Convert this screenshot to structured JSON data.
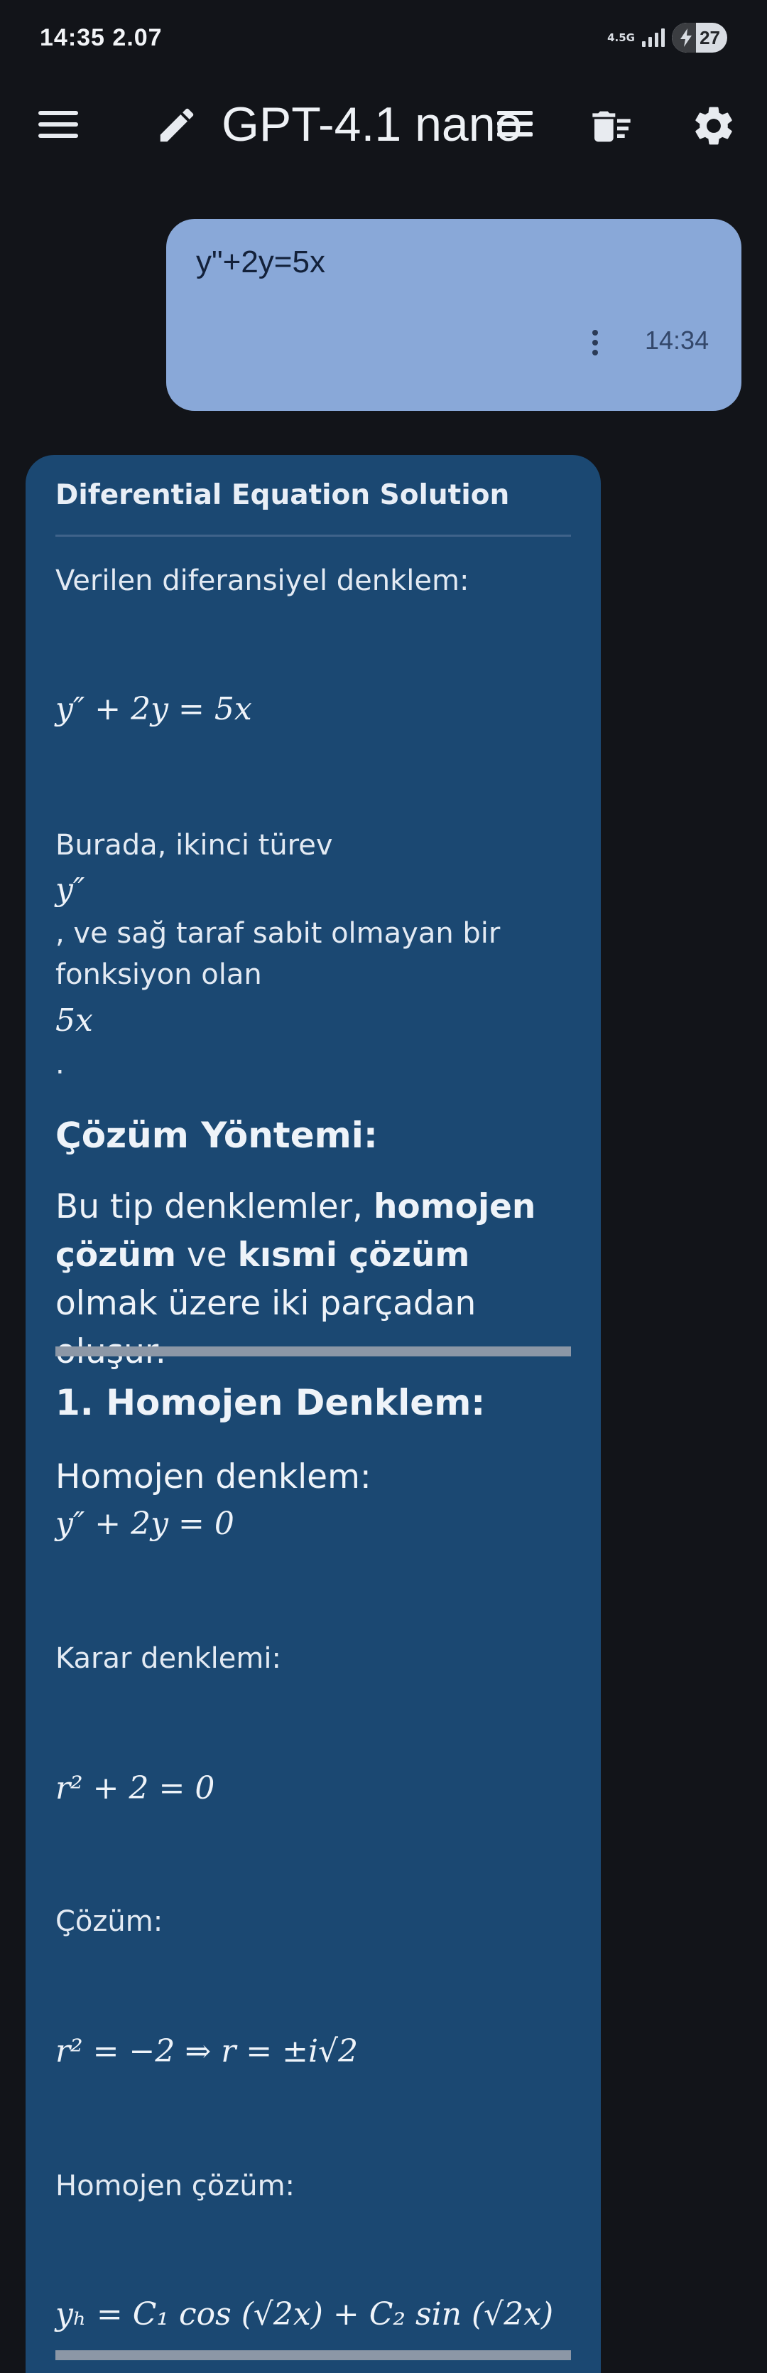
{
  "status_bar": {
    "time": "14:35  2.07",
    "network": "4.5G",
    "battery": "27"
  },
  "app_bar": {
    "title": "GPT-4.1 nano",
    "icons": [
      "menu-icon",
      "pencil-icon",
      "list-icon",
      "delete-sweep-icon",
      "gear-icon"
    ]
  },
  "user_message": {
    "text": "y\"+2y=5x",
    "time": "14:34"
  },
  "ai_message": {
    "heading": "Diferential Equation Solution",
    "intro": "Verilen diferansiyel denklem:",
    "eq_main": "y″ + 2y = 5x",
    "p_burada": "Burada, ikinci türev",
    "eq_ypp": "y″",
    "p_sag": ", ve sağ taraf sabit olmayan bir fonksiyon olan",
    "eq_5x": "5x",
    "p_dot": ".",
    "sec_method": "Çözüm Yöntemi:",
    "method_text": {
      "a": "Bu tip denklemler, ",
      "b": "homojen çözüm",
      "c": " ve ",
      "d": "kısmi çözüm",
      "e": " olmak üzere iki parçadan oluşur."
    },
    "sec_homojen": "1. Homojen Denklem:",
    "homojen_label": "Homojen denklem:",
    "eq_homojen": "y″ + 2y = 0",
    "karar_label": "Karar denklemi:",
    "eq_karar": "r² + 2 = 0",
    "cozum_label": "Çözüm:",
    "eq_cozum": "r² = −2 ⇒ r = ±i√2",
    "homojen_cozum_label": "Homojen çözüm:",
    "eq_yh": "yₕ = C₁ cos (√2x) + C₂ sin (√2x)"
  }
}
